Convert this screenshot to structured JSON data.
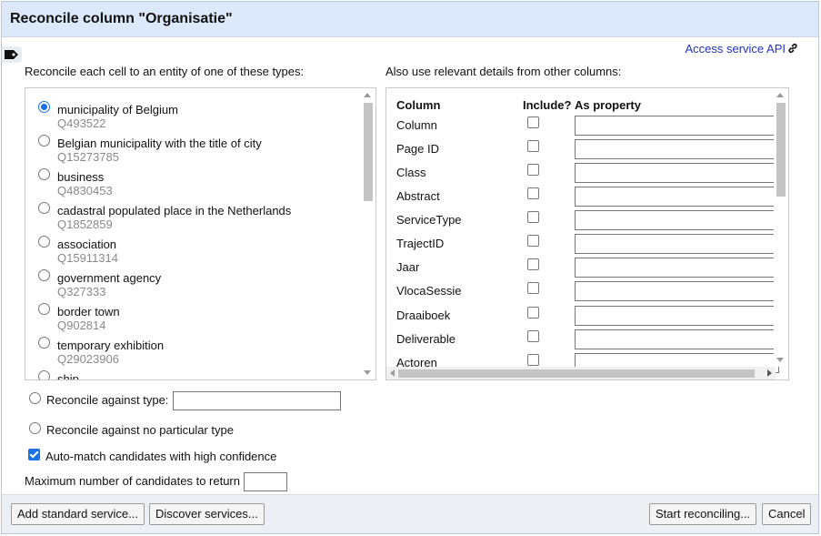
{
  "dialog": {
    "title": "Reconcile column \"Organisatie\"",
    "access_api_label": "Access service API",
    "types_intro": "Reconcile each cell to an entity of one of these types:",
    "columns_intro": "Also use relevant details from other columns:"
  },
  "types": [
    {
      "name": "municipality of Belgium",
      "qid": "Q493522",
      "selected": true
    },
    {
      "name": "Belgian municipality with the title of city",
      "qid": "Q15273785",
      "selected": false
    },
    {
      "name": "business",
      "qid": "Q4830453",
      "selected": false
    },
    {
      "name": "cadastral populated place in the Netherlands",
      "qid": "Q1852859",
      "selected": false
    },
    {
      "name": "association",
      "qid": "Q15911314",
      "selected": false
    },
    {
      "name": "government agency",
      "qid": "Q327333",
      "selected": false
    },
    {
      "name": "border town",
      "qid": "Q902814",
      "selected": false
    },
    {
      "name": "temporary exhibition",
      "qid": "Q29023906",
      "selected": false
    },
    {
      "name": "ship",
      "qid": "",
      "selected": false
    }
  ],
  "columns_table": {
    "headers": {
      "column": "Column",
      "include": "Include?",
      "property": "As property"
    },
    "rows": [
      {
        "name": "Column",
        "include": false,
        "property": ""
      },
      {
        "name": "Page ID",
        "include": false,
        "property": ""
      },
      {
        "name": "Class",
        "include": false,
        "property": ""
      },
      {
        "name": "Abstract",
        "include": false,
        "property": ""
      },
      {
        "name": "ServiceType",
        "include": false,
        "property": ""
      },
      {
        "name": "TrajectID",
        "include": false,
        "property": ""
      },
      {
        "name": "Jaar",
        "include": false,
        "property": ""
      },
      {
        "name": "VlocaSessie",
        "include": false,
        "property": ""
      },
      {
        "name": "Draaiboek",
        "include": false,
        "property": ""
      },
      {
        "name": "Deliverable",
        "include": false,
        "property": ""
      },
      {
        "name": "Actoren",
        "include": false,
        "property": ""
      }
    ]
  },
  "options": {
    "against_type_label": "Reconcile against type:",
    "against_type_value": "",
    "no_type_label": "Reconcile against no particular type",
    "auto_match_label": "Auto-match candidates with high confidence",
    "auto_match_checked": true,
    "max_candidates_label": "Maximum number of candidates to return",
    "max_candidates_value": ""
  },
  "footer": {
    "add_service": "Add standard service...",
    "discover_services": "Discover services...",
    "start": "Start reconciling...",
    "cancel": "Cancel"
  },
  "colors": {
    "title_bar": "#dbe9fb",
    "link": "#2233bb",
    "accent": "#1a73e8",
    "footer": "#eceff3"
  },
  "icons": [
    "tag-icon",
    "link-icon",
    "scroll-up-icon",
    "scroll-down-icon",
    "scroll-left-icon",
    "scroll-right-icon"
  ]
}
